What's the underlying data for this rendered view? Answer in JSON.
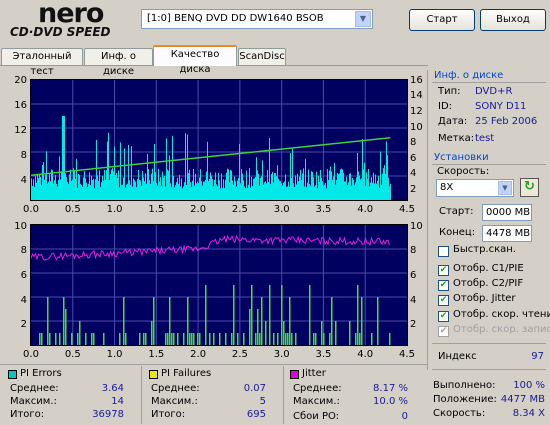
{
  "logo": {
    "brand": "nero",
    "sub": "CD·DVD SPEED"
  },
  "drive": {
    "selected": "[1:0]  BENQ DVD DD DW1640 BSOB"
  },
  "buttons": {
    "start": "Старт",
    "exit": "Выход"
  },
  "tabs": [
    {
      "label": "Эталонный тест"
    },
    {
      "label": "Инф. о диске"
    },
    {
      "label": "Качество диска"
    },
    {
      "label": "ScanDisc"
    }
  ],
  "disc_info": {
    "title": "Инф. о диске",
    "type_label": "Тип:",
    "type_value": "DVD+R",
    "id_label": "ID:",
    "id_value": "SONY D11",
    "date_label": "Дата:",
    "date_value": "25 Feb 2006",
    "mark_label": "Метка:",
    "mark_value": "test"
  },
  "settings": {
    "title": "Установки",
    "speed_label": "Скорость:",
    "speed_value": "8X",
    "start_label": "Старт:",
    "start_value": "0000 MB",
    "end_label": "Конец:",
    "end_value": "4478 MB",
    "checkboxes": [
      {
        "label": "Быстр.скан.",
        "checked": false,
        "disabled": false
      },
      {
        "label": "Отобр. C1/PIE",
        "checked": true,
        "disabled": false
      },
      {
        "label": "Отобр. C2/PIF",
        "checked": true,
        "disabled": false
      },
      {
        "label": "Отобр. Jitter",
        "checked": true,
        "disabled": false
      },
      {
        "label": "Отобр. скор. чтения",
        "checked": true,
        "disabled": false
      },
      {
        "label": "Отобр. скор. записи",
        "checked": true,
        "disabled": true
      }
    ]
  },
  "index": {
    "label": "Индекс",
    "value": "97"
  },
  "progress": {
    "done_label": "Выполнено:",
    "done_value": "100 %",
    "pos_label": "Положение:",
    "pos_value": "4477 MB",
    "speed_label": "Скорость:",
    "speed_value": "8.34 X"
  },
  "stats": {
    "pi_errors": {
      "title": "PI Errors",
      "color": "#00c8c8",
      "avg_label": "Среднее:",
      "avg": "3.64",
      "max_label": "Максим.:",
      "max": "14",
      "total_label": "Итого:",
      "total": "36978"
    },
    "pi_failures": {
      "title": "PI Failures",
      "color": "#e8e800",
      "avg_label": "Среднее:",
      "avg": "0.07",
      "max_label": "Максим.:",
      "max": "5",
      "total_label": "Итого:",
      "total": "695"
    },
    "jitter": {
      "title": "Jitter",
      "color": "#e000e0",
      "avg_label": "Среднее:",
      "avg": "8.17 %",
      "max_label": "Максим.:",
      "max": "10.0 %",
      "po_label": "Сбои PO:",
      "po": "0"
    }
  },
  "colors": {
    "chart_bg": "#000060",
    "grid": "#4a4ab0",
    "pie": "#00e8e8",
    "speed_line": "#40d040",
    "pif": "#40e040",
    "jitter": "#e020e0"
  },
  "chart_data": [
    {
      "type": "bar",
      "name": "PI Errors",
      "x_ticks": [
        "0.0",
        "0.5",
        "1.0",
        "1.5",
        "2.0",
        "2.5",
        "3.0",
        "3.5",
        "4.0",
        "4.5"
      ],
      "y_ticks_left": [
        "20",
        "16",
        "12",
        "8",
        "4"
      ],
      "y_ticks_right": [
        "16",
        "14",
        "12",
        "10",
        "8",
        "6",
        "4",
        "2"
      ],
      "xlim": [
        0,
        4.5
      ],
      "ylim_left": [
        0,
        20
      ],
      "ylim_right": [
        0,
        16
      ],
      "pie_baseline_avg": 3.64,
      "pie_max": 14,
      "read_speed": {
        "x": [
          0.0,
          4.3
        ],
        "y": [
          3.3,
          8.3
        ]
      }
    },
    {
      "type": "bar",
      "name": "PI Failures / Jitter",
      "x_ticks": [
        "0.0",
        "0.5",
        "1.0",
        "1.5",
        "2.0",
        "2.5",
        "3.0",
        "3.5",
        "4.0",
        "4.5"
      ],
      "y_ticks_left": [
        "10",
        "8",
        "6",
        "4",
        "2"
      ],
      "y_ticks_right": [
        "10",
        "8",
        "6",
        "4",
        "2"
      ],
      "xlim": [
        0,
        4.5
      ],
      "ylim_left": [
        0,
        10
      ],
      "ylim_right": [
        0,
        10
      ],
      "pif_max": 5,
      "jitter": {
        "x": [
          0.0,
          2.0,
          2.3,
          4.3
        ],
        "y": [
          7.3,
          8.0,
          8.8,
          8.6
        ]
      }
    }
  ]
}
